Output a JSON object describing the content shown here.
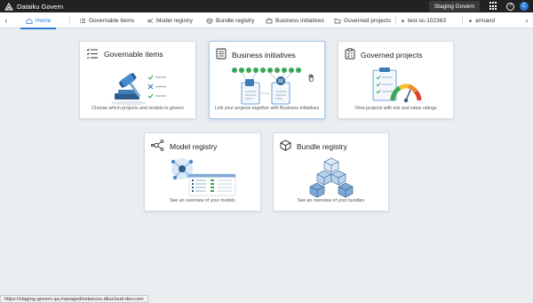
{
  "app": {
    "title": "Dataiku Govern",
    "environment": "Staging Govern",
    "avatar_initial": "C"
  },
  "tabs": [
    {
      "label": "Home",
      "icon": "home-icon",
      "active": true
    },
    {
      "label": "Governable items",
      "icon": "checklist-icon"
    },
    {
      "label": "Model registry",
      "icon": "model-icon"
    },
    {
      "label": "Bundle registry",
      "icon": "cube-icon"
    },
    {
      "label": "Business initiatives",
      "icon": "briefcase-icon"
    },
    {
      "label": "Governed projects",
      "icon": "folder-icon"
    },
    {
      "label": "test-sc-102363",
      "icon": "dot-icon"
    },
    {
      "label": "armand",
      "icon": "dot-icon"
    }
  ],
  "cards": {
    "governable": {
      "title": "Governable items",
      "description": "Choose which projects and models to govern"
    },
    "business": {
      "title": "Business initiatives",
      "description": "Link your projects together with Business Initiatives"
    },
    "governed": {
      "title": "Governed projects",
      "description": "View projects with risk and value ratings"
    },
    "model": {
      "title": "Model registry",
      "description": "See an overview of your models"
    },
    "bundle": {
      "title": "Bundle registry",
      "description": "See an overview of your bundles"
    }
  },
  "status_url": "https://staging-govern.qa.managedinstances.dkucloud-dev.com",
  "colors": {
    "accent": "#2b7bd6",
    "green": "#3aa655",
    "topbar": "#222222"
  }
}
